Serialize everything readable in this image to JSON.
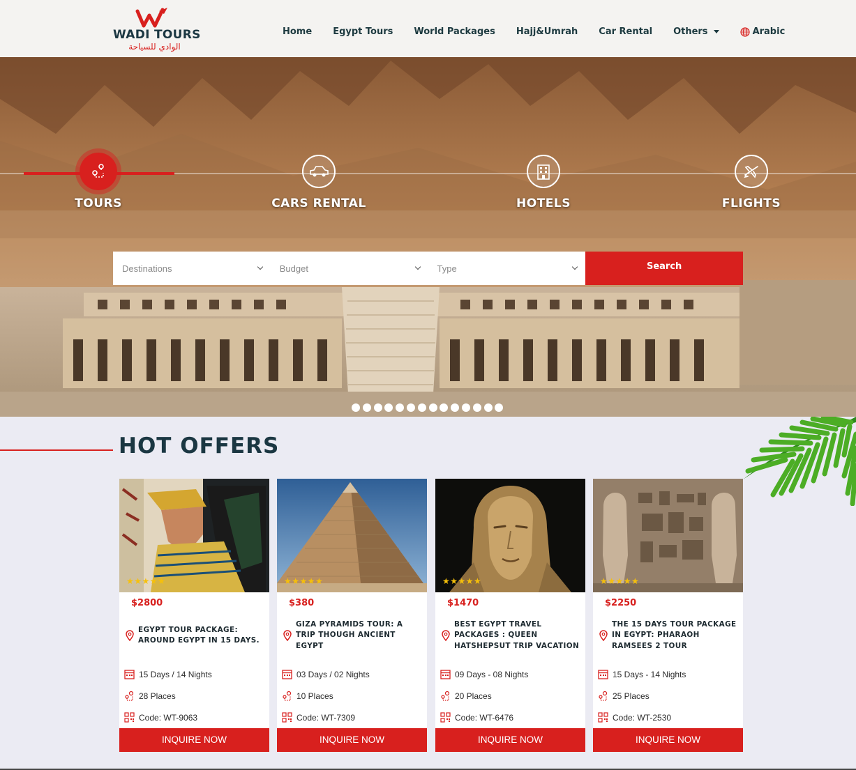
{
  "brand": {
    "name": "WADI TOURS",
    "arabic": "الوادي للسياحة",
    "logo_icon": "w-plane-icon"
  },
  "nav": {
    "items": [
      "Home",
      "Egypt Tours",
      "World Packages",
      "Hajj&Umrah",
      "Car Rental",
      "Others"
    ],
    "language": "Arabic"
  },
  "hero": {
    "tabs": [
      {
        "label": "TOURS",
        "icon": "route-icon",
        "active": true
      },
      {
        "label": "CARS RENTAL",
        "icon": "car-icon",
        "active": false
      },
      {
        "label": "HOTELS",
        "icon": "hotel-icon",
        "active": false
      },
      {
        "label": "FLIGHTS",
        "icon": "plane-icon",
        "active": false
      }
    ],
    "search": {
      "destinations": "Destinations",
      "budget": "Budget",
      "type": "Type",
      "button": "Search"
    },
    "slider_dots": 14
  },
  "offers": {
    "title": "HOT OFFERS",
    "inquire_label": "INQUIRE NOW",
    "cards": [
      {
        "price": "$2800",
        "title": "EGYPT TOUR PACKAGE: AROUND EGYPT IN 15 DAYS.",
        "duration": "15 Days / 14 Nights",
        "places": "28 Places",
        "code": "Code: WT-9063",
        "rating": 5
      },
      {
        "price": "$380",
        "title": "GIZA PYRAMIDS TOUR: A TRIP THOUGH ANCIENT EGYPT",
        "duration": "03 Days / 02 Nights",
        "places": "10 Places",
        "code": "Code: WT-7309",
        "rating": 5
      },
      {
        "price": "$1470",
        "title": "BEST EGYPT TRAVEL PACKAGES : QUEEN HATSHEPSUT TRIP VACATION",
        "duration": "09 Days - 08 Nights",
        "places": "20 Places",
        "code": "Code: WT-6476",
        "rating": 5
      },
      {
        "price": "$2250",
        "title": "THE 15 DAYS TOUR PACKAGE IN EGYPT: PHARAOH RAMSEES 2 TOUR",
        "duration": "15 Days - 14 Nights",
        "places": "25 Places",
        "code": "Code: WT-2530",
        "rating": 5
      }
    ]
  },
  "colors": {
    "accent": "#d8201e",
    "dark": "#1b3742",
    "background": "#ebebf3",
    "star": "#f6c00a"
  }
}
